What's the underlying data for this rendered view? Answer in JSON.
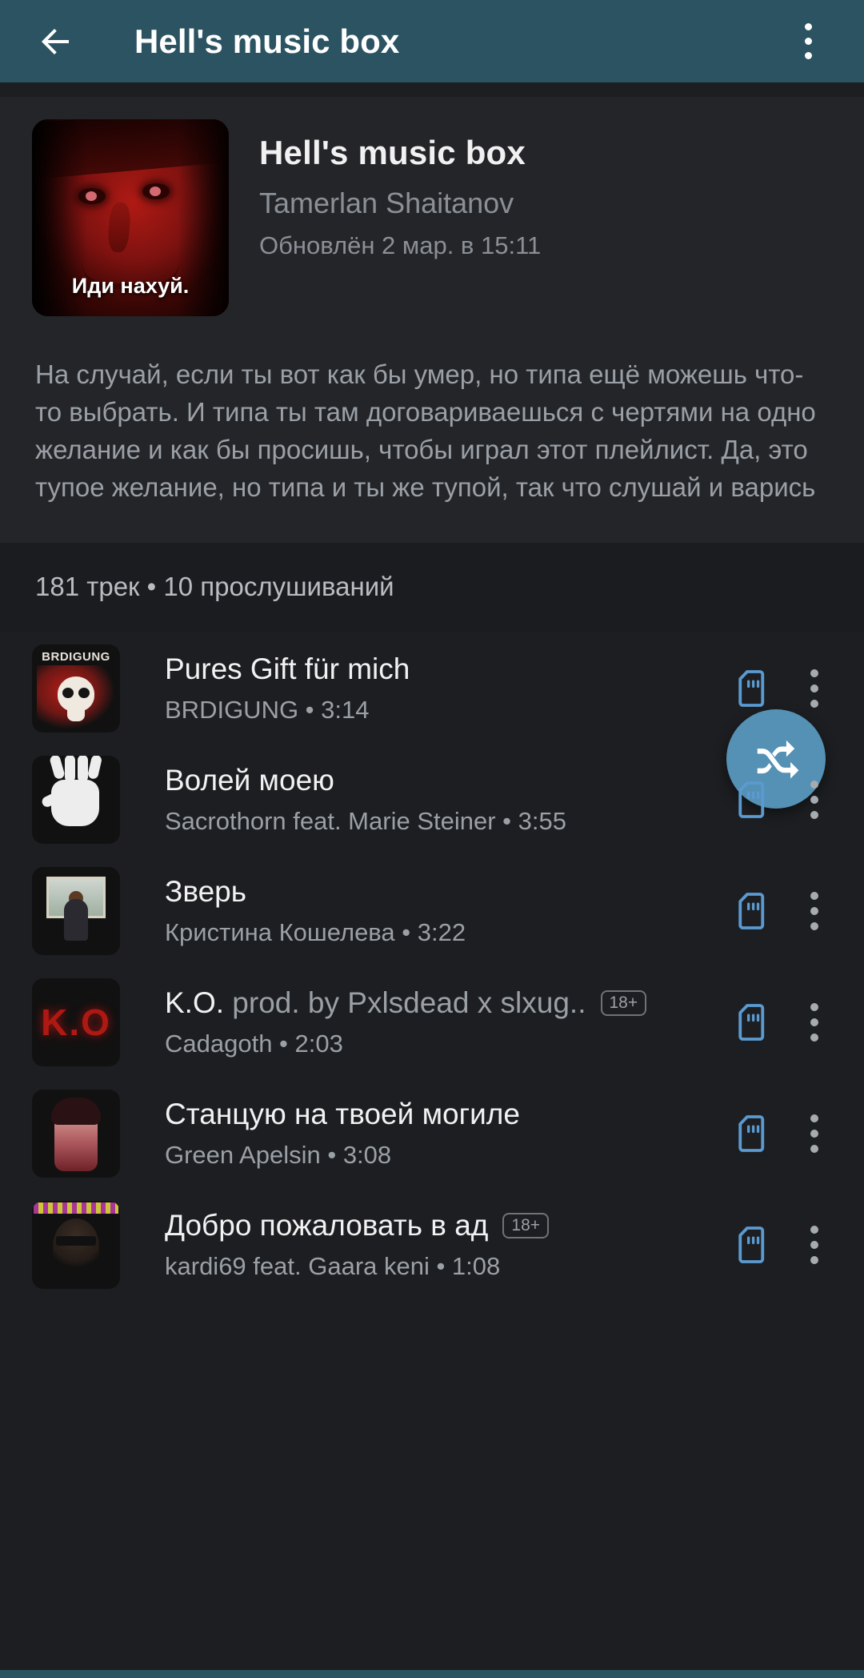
{
  "appbar": {
    "back_icon": "arrow-left-icon",
    "title": "Hell's music box",
    "overflow_icon": "kebab-menu-icon",
    "background_color": "#2b5362"
  },
  "playlist": {
    "cover_caption": "Иди нахуй.",
    "title": "Hell's music box",
    "artist": "Tamerlan Shaitanov",
    "updated": "Обновлён 2 мар. в 15:11",
    "description": "На случай, если ты вот как бы умер, но типа ещё можешь что-то выбрать. И типа ты там договариваешься с чертями на одно желание и как бы просишь, чтобы играл этот плейлист. Да, это тупое желание, но типа и ты же тупой, так что слушай и варись",
    "stats": "181 трек • 10 прослушиваний",
    "shuffle_icon": "shuffle-icon",
    "shuffle_color": "#5590b5"
  },
  "tracks": [
    {
      "title": "Pures Gift für mich",
      "title_dim": "",
      "badge": "",
      "subtitle": "BRDIGUNG • 3:14",
      "artist": "BRDIGUNG",
      "duration": "3:14",
      "offline_icon": "sd-card-icon",
      "menu_icon": "kebab-menu-icon"
    },
    {
      "title": "Волей моею",
      "title_dim": "",
      "badge": "",
      "subtitle": "Sacrothorn feat. Marie Steiner • 3:55",
      "artist": "Sacrothorn feat. Marie Steiner",
      "duration": "3:55",
      "offline_icon": "sd-card-icon",
      "menu_icon": "kebab-menu-icon"
    },
    {
      "title": "Зверь",
      "title_dim": "",
      "badge": "",
      "subtitle": "Кристина Кошелева • 3:22",
      "artist": "Кристина Кошелева",
      "duration": "3:22",
      "offline_icon": "sd-card-icon",
      "menu_icon": "kebab-menu-icon"
    },
    {
      "title": "K.O.",
      "title_dim": " prod. by Pxlsdead x slxug..",
      "badge": "18+",
      "subtitle": "Cadagoth • 2:03",
      "artist": "Cadagoth",
      "duration": "2:03",
      "offline_icon": "sd-card-icon",
      "menu_icon": "kebab-menu-icon"
    },
    {
      "title": "Станцую на твоей могиле",
      "title_dim": "",
      "badge": "",
      "subtitle": "Green Apelsin • 3:08",
      "artist": "Green Apelsin",
      "duration": "3:08",
      "offline_icon": "sd-card-icon",
      "menu_icon": "kebab-menu-icon"
    },
    {
      "title": "Добро пожаловать в ад",
      "title_dim": "",
      "badge": "18+",
      "subtitle": "kardi69 feat. Gaara keni • 1:08",
      "artist": "kardi69 feat. Gaara keni",
      "duration": "1:08",
      "offline_icon": "sd-card-icon",
      "menu_icon": "kebab-menu-icon"
    }
  ]
}
